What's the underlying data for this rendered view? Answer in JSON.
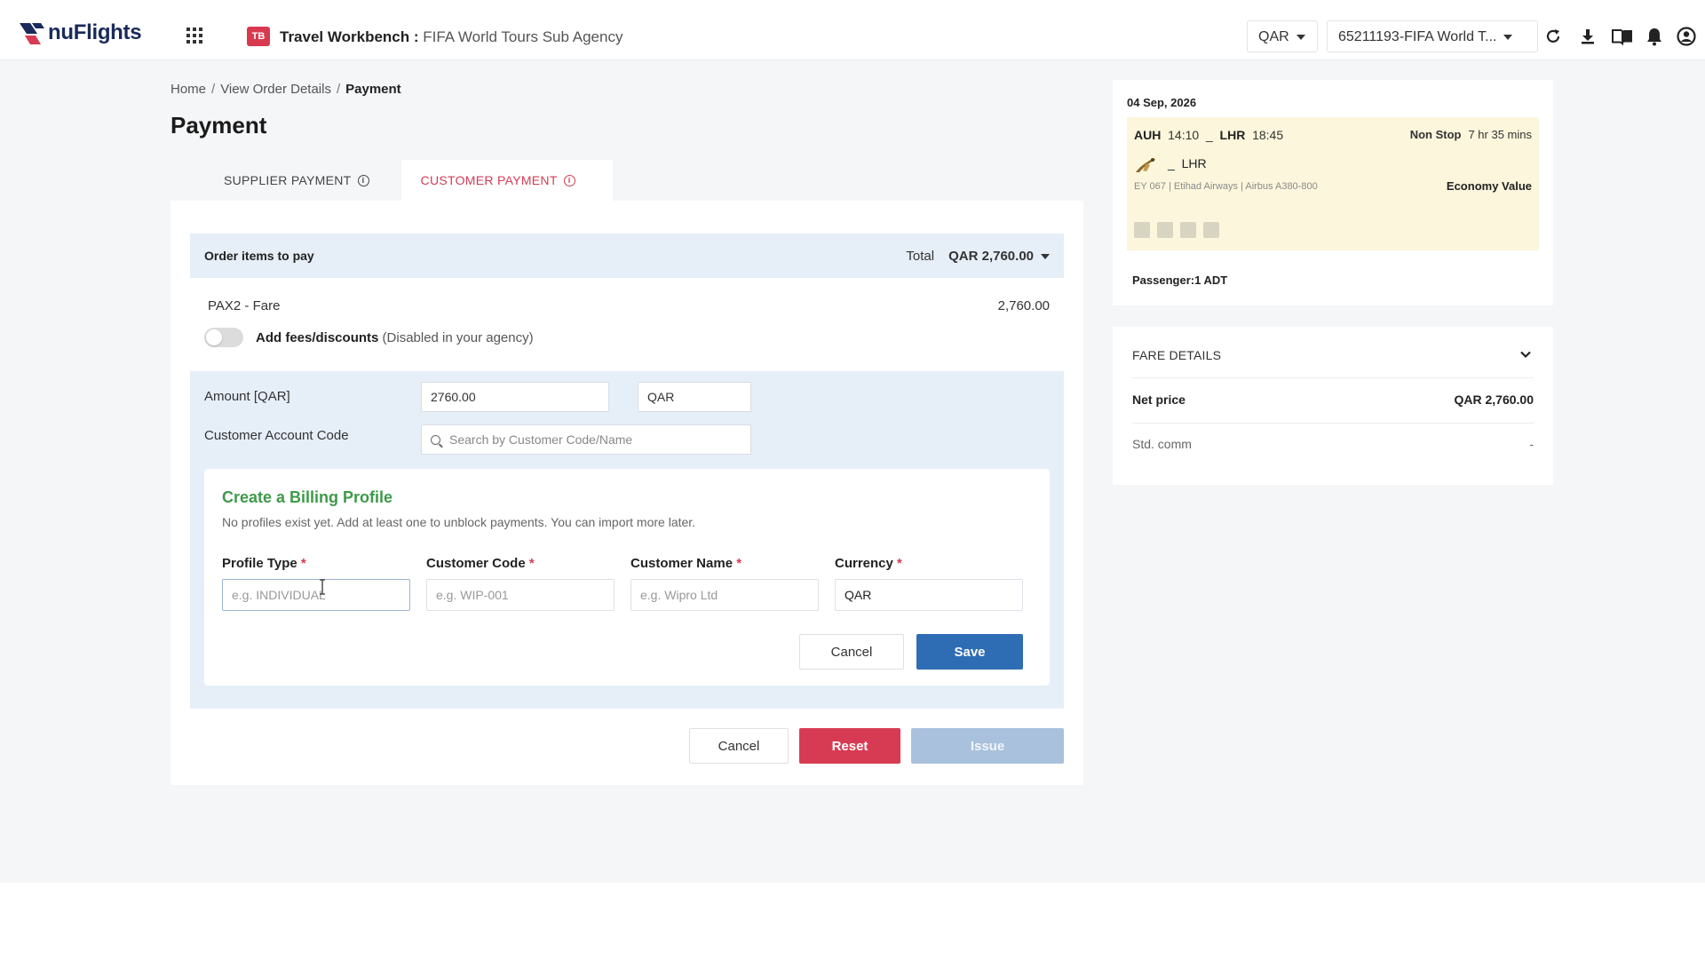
{
  "header": {
    "logo_text": "nuFlights",
    "workbench_badge": "TB",
    "workbench_title": "Travel Workbench :",
    "agency": "FIFA World Tours Sub Agency",
    "currency": "QAR",
    "account": "65211193-FIFA World T...",
    "icons": [
      "refresh-icon",
      "download-icon",
      "book-icon",
      "bell-icon",
      "user-icon"
    ]
  },
  "breadcrumb": [
    "Home",
    "View Order Details",
    "Payment"
  ],
  "page_title": "Payment",
  "tabs": [
    {
      "label": "SUPPLIER PAYMENT",
      "active": false
    },
    {
      "label": "CUSTOMER PAYMENT",
      "active": true
    }
  ],
  "order": {
    "header_label": "Order items to pay",
    "total_label": "Total",
    "total_value": "QAR 2,760.00",
    "item_label": "PAX2  - Fare",
    "item_amount": "2,760.00",
    "toggle_label": "Add fees/discounts",
    "toggle_note": "(Disabled in your agency)",
    "toggle_on": false
  },
  "payment": {
    "amount_label": "Amount [QAR]",
    "amount_value": "2760.00",
    "currency_value": "QAR",
    "account_label": "Customer Account Code",
    "account_placeholder": "Search by Customer Code/Name"
  },
  "billing": {
    "title": "Create a Billing Profile",
    "description": "No profiles exist yet. Add at least one to unblock payments. You can import more later.",
    "fields": [
      {
        "label": "Profile Type",
        "placeholder": "e.g. INDIVIDUAL",
        "value": ""
      },
      {
        "label": "Customer Code",
        "placeholder": "e.g. WIP-001",
        "value": ""
      },
      {
        "label": "Customer Name",
        "placeholder": "e.g. Wipro Ltd",
        "value": ""
      },
      {
        "label": "Currency",
        "placeholder": "",
        "value": "QAR"
      }
    ],
    "required_mark": "*",
    "cancel_label": "Cancel",
    "save_label": "Save"
  },
  "actions": {
    "cancel_label": "Cancel",
    "reset_label": "Reset",
    "issue_label": "Issue"
  },
  "flight": {
    "date": "04 Sep, 2026",
    "from": "AUH",
    "depart": "14:10",
    "to": "LHR",
    "arrive": "18:45",
    "stops": "Non Stop",
    "duration": "7 hr 35 mins",
    "route_dest": "LHR",
    "details": "EY 067 | Etihad Airways | Airbus A380-800",
    "cabin": "Economy Value",
    "passengers": "Passenger:1 ADT"
  },
  "fare": {
    "heading": "FARE DETAILS",
    "net_label": "Net price",
    "net_value": "QAR 2,760.00",
    "comm_label": "Std. comm",
    "comm_value": "-"
  },
  "colors": {
    "accent_red": "#d73b53",
    "primary_blue": "#2e6db4",
    "billing_green": "#3d9a49",
    "panel_blue": "#e6eef8",
    "flight_box": "#fbf6dc"
  }
}
